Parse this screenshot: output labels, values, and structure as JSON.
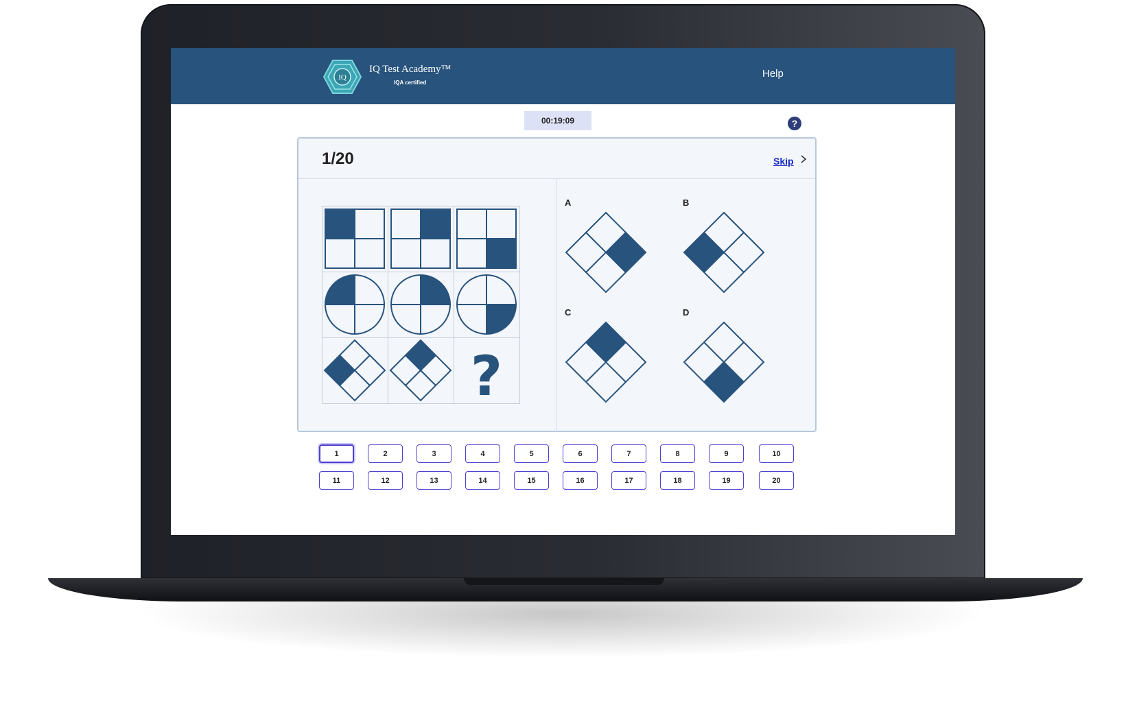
{
  "app": {
    "brand_name": "IQ Test Academy™",
    "brand_sub": "IQA certified",
    "logo_text": "IQ",
    "help_label": "Help",
    "primary_color": "#27537d"
  },
  "timer": {
    "value": "00:19:09"
  },
  "question": {
    "counter": "1/20",
    "skip_label": "Skip",
    "missing_symbol": "?",
    "fill_color": "#27537d",
    "options": [
      {
        "letter": "A",
        "filled_quadrant": "right"
      },
      {
        "letter": "B",
        "filled_quadrant": "left"
      },
      {
        "letter": "C",
        "filled_quadrant": "top"
      },
      {
        "letter": "D",
        "filled_quadrant": "bottom"
      }
    ]
  },
  "navigation": {
    "current": "1",
    "row1": [
      "1",
      "2",
      "3",
      "4",
      "5",
      "6",
      "7",
      "8",
      "9",
      "10"
    ],
    "row2": [
      "11",
      "12",
      "13",
      "14",
      "15",
      "16",
      "17",
      "18",
      "19",
      "20"
    ]
  }
}
